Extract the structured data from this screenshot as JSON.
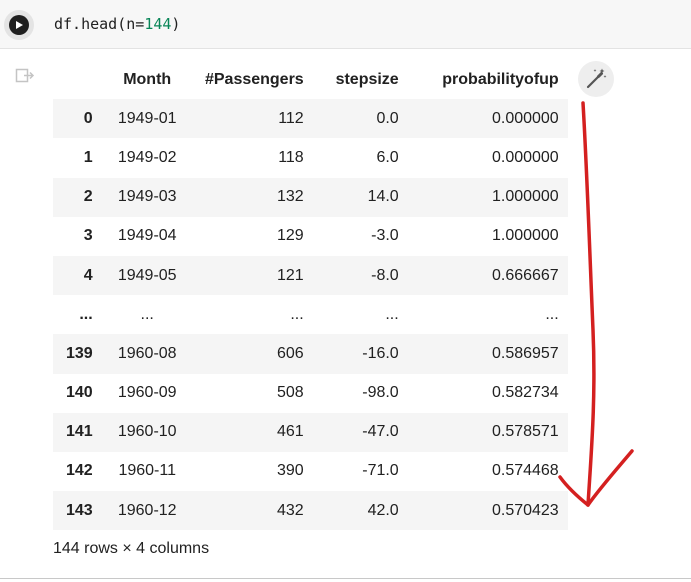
{
  "cell": {
    "code_prefix": "df.head(n=",
    "code_number": "144",
    "code_suffix": ")"
  },
  "dataframe": {
    "columns": [
      "Month",
      "#Passengers",
      "stepsize",
      "probabilityofup"
    ],
    "rows": [
      {
        "index": "0",
        "cells": [
          "1949-01",
          "112",
          "0.0",
          "0.000000"
        ]
      },
      {
        "index": "1",
        "cells": [
          "1949-02",
          "118",
          "6.0",
          "0.000000"
        ]
      },
      {
        "index": "2",
        "cells": [
          "1949-03",
          "132",
          "14.0",
          "1.000000"
        ]
      },
      {
        "index": "3",
        "cells": [
          "1949-04",
          "129",
          "-3.0",
          "1.000000"
        ]
      },
      {
        "index": "4",
        "cells": [
          "1949-05",
          "121",
          "-8.0",
          "0.666667"
        ]
      },
      {
        "index": "...",
        "cells": [
          "...",
          "...",
          "...",
          "..."
        ]
      },
      {
        "index": "139",
        "cells": [
          "1960-08",
          "606",
          "-16.0",
          "0.586957"
        ]
      },
      {
        "index": "140",
        "cells": [
          "1960-09",
          "508",
          "-98.0",
          "0.582734"
        ]
      },
      {
        "index": "141",
        "cells": [
          "1960-10",
          "461",
          "-47.0",
          "0.578571"
        ]
      },
      {
        "index": "142",
        "cells": [
          "1960-11",
          "390",
          "-71.0",
          "0.574468"
        ]
      },
      {
        "index": "143",
        "cells": [
          "1960-12",
          "432",
          "42.0",
          "0.570423"
        ]
      }
    ],
    "shape_text": "144 rows × 4 columns"
  },
  "icons": {
    "run": "play-icon",
    "output": "output-icon",
    "suggest": "magic-wand-icon"
  },
  "colors": {
    "annotation_arrow": "#d42020",
    "number_literal": "#098658",
    "stripe": "#f5f5f5"
  }
}
